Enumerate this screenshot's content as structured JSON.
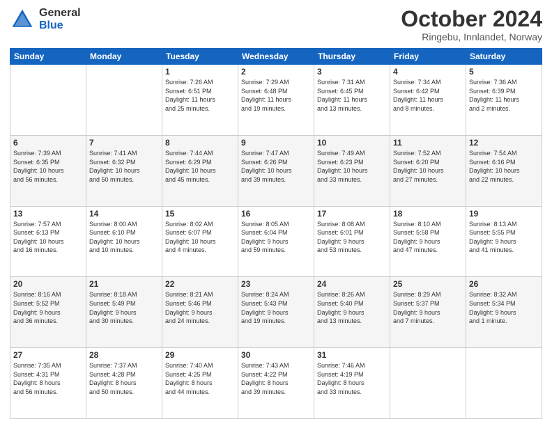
{
  "header": {
    "logo_general": "General",
    "logo_blue": "Blue",
    "month_title": "October 2024",
    "subtitle": "Ringebu, Innlandet, Norway"
  },
  "days_of_week": [
    "Sunday",
    "Monday",
    "Tuesday",
    "Wednesday",
    "Thursday",
    "Friday",
    "Saturday"
  ],
  "weeks": [
    [
      {
        "day": "",
        "info": ""
      },
      {
        "day": "",
        "info": ""
      },
      {
        "day": "1",
        "info": "Sunrise: 7:26 AM\nSunset: 6:51 PM\nDaylight: 11 hours\nand 25 minutes."
      },
      {
        "day": "2",
        "info": "Sunrise: 7:29 AM\nSunset: 6:48 PM\nDaylight: 11 hours\nand 19 minutes."
      },
      {
        "day": "3",
        "info": "Sunrise: 7:31 AM\nSunset: 6:45 PM\nDaylight: 11 hours\nand 13 minutes."
      },
      {
        "day": "4",
        "info": "Sunrise: 7:34 AM\nSunset: 6:42 PM\nDaylight: 11 hours\nand 8 minutes."
      },
      {
        "day": "5",
        "info": "Sunrise: 7:36 AM\nSunset: 6:39 PM\nDaylight: 11 hours\nand 2 minutes."
      }
    ],
    [
      {
        "day": "6",
        "info": "Sunrise: 7:39 AM\nSunset: 6:35 PM\nDaylight: 10 hours\nand 56 minutes."
      },
      {
        "day": "7",
        "info": "Sunrise: 7:41 AM\nSunset: 6:32 PM\nDaylight: 10 hours\nand 50 minutes."
      },
      {
        "day": "8",
        "info": "Sunrise: 7:44 AM\nSunset: 6:29 PM\nDaylight: 10 hours\nand 45 minutes."
      },
      {
        "day": "9",
        "info": "Sunrise: 7:47 AM\nSunset: 6:26 PM\nDaylight: 10 hours\nand 39 minutes."
      },
      {
        "day": "10",
        "info": "Sunrise: 7:49 AM\nSunset: 6:23 PM\nDaylight: 10 hours\nand 33 minutes."
      },
      {
        "day": "11",
        "info": "Sunrise: 7:52 AM\nSunset: 6:20 PM\nDaylight: 10 hours\nand 27 minutes."
      },
      {
        "day": "12",
        "info": "Sunrise: 7:54 AM\nSunset: 6:16 PM\nDaylight: 10 hours\nand 22 minutes."
      }
    ],
    [
      {
        "day": "13",
        "info": "Sunrise: 7:57 AM\nSunset: 6:13 PM\nDaylight: 10 hours\nand 16 minutes."
      },
      {
        "day": "14",
        "info": "Sunrise: 8:00 AM\nSunset: 6:10 PM\nDaylight: 10 hours\nand 10 minutes."
      },
      {
        "day": "15",
        "info": "Sunrise: 8:02 AM\nSunset: 6:07 PM\nDaylight: 10 hours\nand 4 minutes."
      },
      {
        "day": "16",
        "info": "Sunrise: 8:05 AM\nSunset: 6:04 PM\nDaylight: 9 hours\nand 59 minutes."
      },
      {
        "day": "17",
        "info": "Sunrise: 8:08 AM\nSunset: 6:01 PM\nDaylight: 9 hours\nand 53 minutes."
      },
      {
        "day": "18",
        "info": "Sunrise: 8:10 AM\nSunset: 5:58 PM\nDaylight: 9 hours\nand 47 minutes."
      },
      {
        "day": "19",
        "info": "Sunrise: 8:13 AM\nSunset: 5:55 PM\nDaylight: 9 hours\nand 41 minutes."
      }
    ],
    [
      {
        "day": "20",
        "info": "Sunrise: 8:16 AM\nSunset: 5:52 PM\nDaylight: 9 hours\nand 36 minutes."
      },
      {
        "day": "21",
        "info": "Sunrise: 8:18 AM\nSunset: 5:49 PM\nDaylight: 9 hours\nand 30 minutes."
      },
      {
        "day": "22",
        "info": "Sunrise: 8:21 AM\nSunset: 5:46 PM\nDaylight: 9 hours\nand 24 minutes."
      },
      {
        "day": "23",
        "info": "Sunrise: 8:24 AM\nSunset: 5:43 PM\nDaylight: 9 hours\nand 19 minutes."
      },
      {
        "day": "24",
        "info": "Sunrise: 8:26 AM\nSunset: 5:40 PM\nDaylight: 9 hours\nand 13 minutes."
      },
      {
        "day": "25",
        "info": "Sunrise: 8:29 AM\nSunset: 5:37 PM\nDaylight: 9 hours\nand 7 minutes."
      },
      {
        "day": "26",
        "info": "Sunrise: 8:32 AM\nSunset: 5:34 PM\nDaylight: 9 hours\nand 1 minute."
      }
    ],
    [
      {
        "day": "27",
        "info": "Sunrise: 7:35 AM\nSunset: 4:31 PM\nDaylight: 8 hours\nand 56 minutes."
      },
      {
        "day": "28",
        "info": "Sunrise: 7:37 AM\nSunset: 4:28 PM\nDaylight: 8 hours\nand 50 minutes."
      },
      {
        "day": "29",
        "info": "Sunrise: 7:40 AM\nSunset: 4:25 PM\nDaylight: 8 hours\nand 44 minutes."
      },
      {
        "day": "30",
        "info": "Sunrise: 7:43 AM\nSunset: 4:22 PM\nDaylight: 8 hours\nand 39 minutes."
      },
      {
        "day": "31",
        "info": "Sunrise: 7:46 AM\nSunset: 4:19 PM\nDaylight: 8 hours\nand 33 minutes."
      },
      {
        "day": "",
        "info": ""
      },
      {
        "day": "",
        "info": ""
      }
    ]
  ]
}
